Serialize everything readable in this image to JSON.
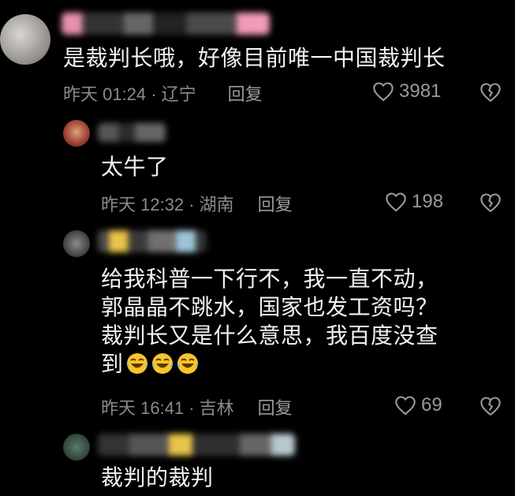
{
  "comments": [
    {
      "text": "是裁判长哦，好像目前唯一中国裁判长",
      "time": "昨天 01:24 ·",
      "location": "辽宁",
      "reply": "回复",
      "likes": "3981"
    },
    {
      "text": "太牛了",
      "time": "昨天 12:32 ·",
      "location": "湖南",
      "reply": "回复",
      "likes": "198"
    },
    {
      "text_lines": [
        "给我科普一下行不，我一直不动，",
        "郭晶晶不跳水，国家也发工资吗？",
        "裁判长又是什么意思，我百度没查",
        "到"
      ],
      "emoji_icon": "laughing-crying-face-icon",
      "time": "昨天 16:41 ·",
      "location": "吉林",
      "reply": "回复",
      "likes": "69"
    },
    {
      "text": "裁判的裁判"
    }
  ],
  "colors": {
    "background": "#000000",
    "text": "#f2f2f2",
    "meta": "#8b8b8b"
  }
}
